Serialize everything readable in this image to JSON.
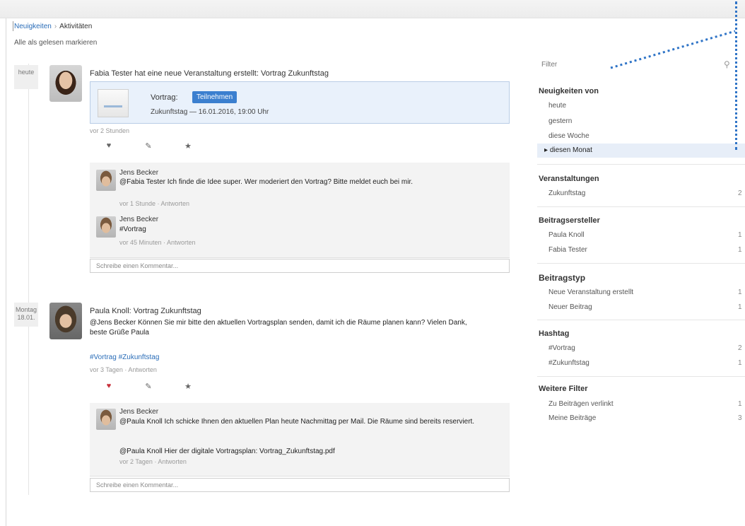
{
  "breadcrumb": {
    "home": "Neuigkeiten",
    "current": "Aktivitäten"
  },
  "mark_read": "Alle als gelesen markieren",
  "posts": [
    {
      "date_label": "heute",
      "title": "Fabia Tester hat eine neue Veranstaltung erstellt: Vortrag Zukunftstag",
      "event": {
        "label": "Vortrag:",
        "badge": "Teilnehmen",
        "info": "Zukunftstag — 16.01.2016, 19:00 Uhr"
      },
      "meta": "vor 2 Stunden",
      "comments": [
        {
          "author": "Jens Becker",
          "text": "@Fabia Tester Ich finde die Idee super. Wer moderiert den Vortrag? Bitte meldet euch bei mir.",
          "meta": "vor 1 Stunde · Antworten"
        },
        {
          "author": "Jens Becker",
          "text": "#Vortrag",
          "meta": "vor 45 Minuten · Antworten"
        }
      ],
      "reply_placeholder": "Schreibe einen Kommentar..."
    },
    {
      "date_label": "Montag\n18.01.",
      "title": "Paula Knoll: Vortrag Zukunftstag",
      "body": "@Jens Becker Können Sie mir bitte den aktuellen Vortragsplan senden, damit ich die Räume planen kann? Vielen Dank, beste Grüße Paula",
      "hashtag": "#Vortrag #Zukunftstag",
      "meta": "vor 3 Tagen · Antworten",
      "comments": [
        {
          "author": "Jens Becker",
          "text": "@Paula Knoll Ich schicke Ihnen den aktuellen Plan heute Nachmittag per Mail. Die Räume sind bereits reserviert.",
          "link": "@Paula Knoll Hier der digitale Vortragsplan: Vortrag_Zukunftstag.pdf",
          "meta": "vor 2 Tagen · Antworten"
        }
      ],
      "reply_placeholder": "Schreibe einen Kommentar..."
    }
  ],
  "sidebar": {
    "filter_label": "Filter",
    "sections": [
      {
        "title": "Neuigkeiten von",
        "items": [
          "heute",
          "gestern",
          "diese Woche",
          "diesen Monat"
        ],
        "selected": "diesen Monat"
      },
      {
        "title": "Veranstaltungen",
        "items": [
          {
            "label": "Zukunftstag",
            "count": "2"
          }
        ]
      },
      {
        "title": "Beitragsersteller",
        "items": [
          {
            "label": "Paula Knoll",
            "count": "1"
          },
          {
            "label": "Fabia Tester",
            "count": "1"
          }
        ]
      },
      {
        "title": "Beitragstyp",
        "items": [
          {
            "label": "Neue Veranstaltung erstellt",
            "count": "1"
          },
          {
            "label": "Neuer Beitrag",
            "count": "1"
          }
        ]
      },
      {
        "title": "Hashtag",
        "items": [
          {
            "label": "#Vortrag",
            "count": "2"
          },
          {
            "label": "#Zukunftstag",
            "count": "1"
          }
        ]
      },
      {
        "title": "Weitere Filter",
        "items": [
          {
            "label": "Zu Beiträgen verlinkt",
            "count": "1"
          },
          {
            "label": "Meine Beiträge",
            "count": "3"
          }
        ]
      }
    ]
  }
}
